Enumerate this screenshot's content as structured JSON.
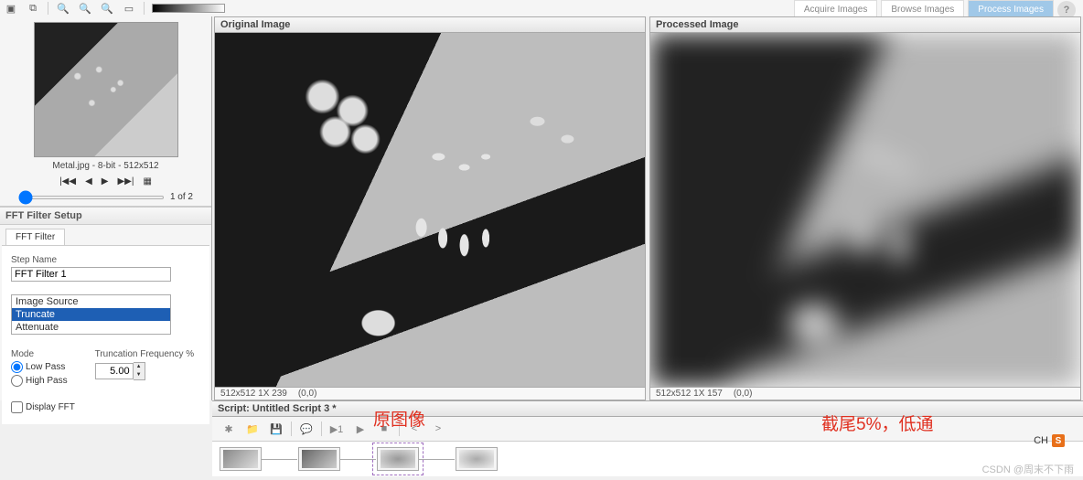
{
  "topTabs": {
    "acquire": "Acquire Images",
    "browse": "Browse Images",
    "process": "Process Images"
  },
  "thumbnail": {
    "caption": "Metal.jpg - 8-bit - 512x512",
    "pager": "1 of 2"
  },
  "nav": {
    "first": "|◀◀",
    "prev": "◀",
    "next": "▶",
    "last": "▶▶|",
    "grid": "▦"
  },
  "setup": {
    "header": "FFT Filter Setup",
    "tab": "FFT Filter",
    "stepNameLabel": "Step Name",
    "stepNameValue": "FFT Filter 1",
    "listbox": {
      "opt1": "Image Source",
      "opt2": "Truncate",
      "opt3": "Attenuate"
    },
    "modeLabel": "Mode",
    "lowPass": "Low Pass",
    "highPass": "High Pass",
    "freqLabel": "Truncation Frequency %",
    "freqValue": "5.00",
    "displayFFT": "Display FFT"
  },
  "panels": {
    "original": {
      "title": "Original Image",
      "dims": "512x512 1X 239",
      "coord": "(0,0)"
    },
    "processed": {
      "title": "Processed Image",
      "dims": "512x512 1X 157",
      "coord": "(0,0)"
    }
  },
  "script": {
    "title": "Script: Untitled Script 3 *"
  },
  "annotations": {
    "a1": "原图像",
    "a2": "截尾5%，低通"
  },
  "lang": {
    "ch": "CH",
    "s": "S"
  },
  "watermark": "CSDN @周末不下雨"
}
